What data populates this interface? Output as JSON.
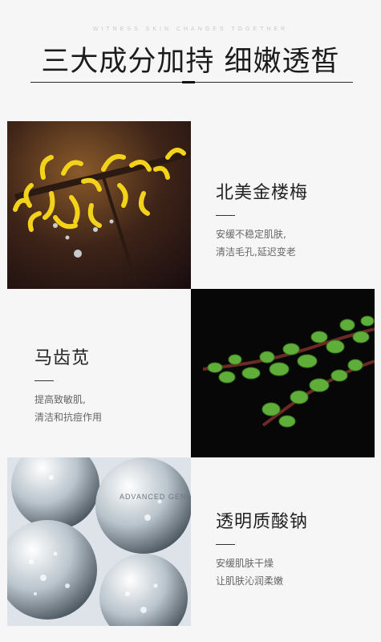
{
  "header": {
    "tagline": "WITNESS SKIN CHANGES TOGETHER",
    "headline": "三大成分加持  细嫩透皙"
  },
  "ingredients": [
    {
      "name": "北美金楼梅",
      "desc_line1": "安缓不稳定肌肤,",
      "desc_line2": "清洁毛孔,延迟变老",
      "image": "witch-hazel-flower"
    },
    {
      "name": "马齿苋",
      "desc_line1": "提高致敏肌,",
      "desc_line2": "清洁和抗痘作用",
      "image": "purslane-plant"
    },
    {
      "name": "透明质酸钠",
      "desc_line1": "安缓肌肤干燥",
      "desc_line2": "让肌肤沁润柔嫩",
      "image": "hyaluronic-bubble-spheres",
      "sphere_text": "ADVANCED GENI"
    }
  ]
}
